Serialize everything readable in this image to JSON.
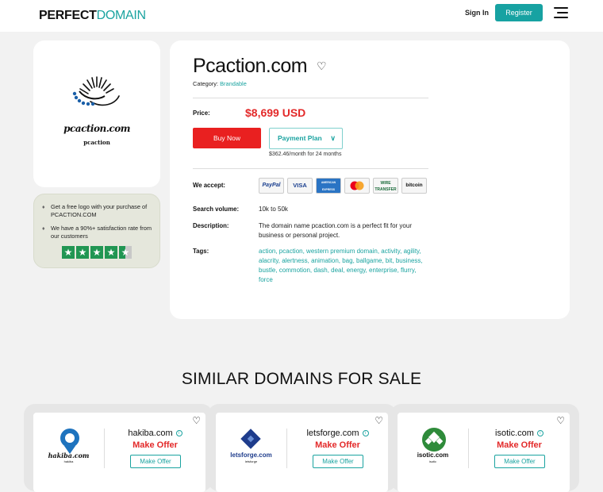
{
  "header": {
    "logo_part1": "PERFECT",
    "logo_part2": "DOMAIN",
    "signin_label": "Sign In",
    "register_label": "Register",
    "menu_icon": "hamburger-icon"
  },
  "logo_card": {
    "text1": "pcaction.com",
    "text2": "pcaction"
  },
  "promo": {
    "item1": "Get a free logo with your purchase of PCACTION.COM",
    "item2": "We have a 90%+ satisfaction rate from our customers",
    "rating_stars": 4.5
  },
  "listing": {
    "domain": "Pcaction.com",
    "category_label": "Category:",
    "category_value": "Brandable",
    "price_label": "Price:",
    "price_value": "$8,699 USD",
    "buy_label": "Buy Now",
    "plan_label": "Payment Plan",
    "plan_note": "$362.46/month for 24 months",
    "accept_label": "We accept:",
    "payments": [
      "PayPal",
      "VISA",
      "AMERICAN EXPRESS",
      "mastercard",
      "WIRE TRANSFER",
      "bitcoin"
    ],
    "search_volume_label": "Search volume:",
    "search_volume_value": "10k to 50k",
    "description_label": "Description:",
    "description_value": "The domain name pcaction.com is a perfect fit for your business or personal project.",
    "tags_label": "Tags:",
    "tags_value": "action, pcaction, western premium domain, activity, agility, alacrity, alertness, animation, bag, ballgame, bit, business, bustle, commotion, dash, deal, energy, enterprise, flurry, force"
  },
  "similar": {
    "title": "SIMILAR DOMAINS FOR SALE",
    "offer_label": "Make Offer",
    "offer_button": "Make Offer",
    "cards": [
      {
        "name": "hakiba.com",
        "logo_text": "hakiba.com",
        "logo_sub": "hakiba",
        "color": "#1e73be"
      },
      {
        "name": "letsforge.com",
        "logo_text": "letsforge.com",
        "logo_sub": "letsforge",
        "color": "#1e3c8c"
      },
      {
        "name": "isotic.com",
        "logo_text": "isotic.com",
        "logo_sub": "isotic",
        "color": "#2e8b3a"
      }
    ]
  }
}
